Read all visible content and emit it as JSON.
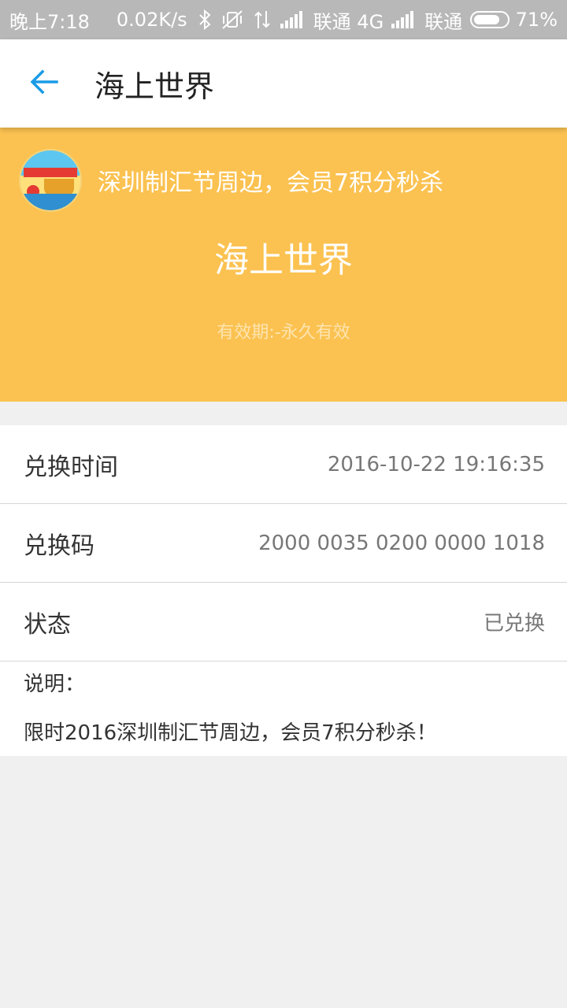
{
  "status_bar": {
    "time": "晚上7:18",
    "speed": "0.02K/s",
    "carrier1": "联通 4G",
    "carrier2": "联通",
    "battery": "71%",
    "icons": [
      "bluetooth-icon",
      "vibrate-off-icon",
      "data-arrows-icon",
      "signal-icon",
      "signal-icon"
    ]
  },
  "app_bar": {
    "title": "海上世界",
    "back_icon": "arrow-left-icon",
    "accent_color": "#1a9be6"
  },
  "hero": {
    "subtitle": "深圳制汇节周边，会员7积分秒杀",
    "title": "海上世界",
    "validity": "有效期:-永久有效",
    "background_color": "#fbc251"
  },
  "details": {
    "rows": [
      {
        "label": "兑换时间",
        "value": "2016-10-22 19:16:35"
      },
      {
        "label": "兑换码",
        "value": "2000 0035 0200 0000 1018"
      },
      {
        "label": "状态",
        "value": "已兑换"
      }
    ],
    "description_label": "说明：",
    "description_text": "限时2016深圳制汇节周边，会员7积分秒杀！"
  }
}
